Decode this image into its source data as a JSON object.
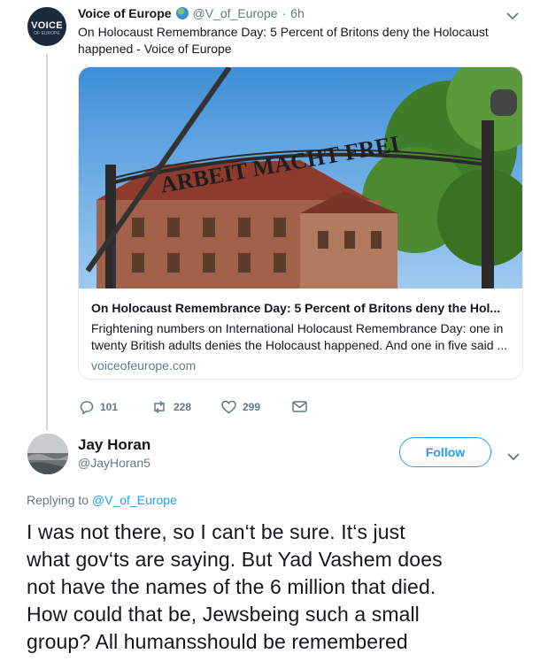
{
  "tweet1": {
    "avatar_text": "VOICE",
    "avatar_subtext": "OF EUROPE",
    "name": "Voice of Europe",
    "handle": "@V_of_Europe",
    "separator": "·",
    "time": "6h",
    "text": "On Holocaust Remembrance Day: 5 Percent of Britons deny the Holocaust happened - Voice of Europe",
    "card": {
      "title": "On Holocaust Remembrance Day: 5 Percent of Britons deny the Hol...",
      "desc_line1": "Frightening numbers on International Holocaust Remembrance Day: one in",
      "desc_line2": "twenty British adults denies the Holocaust happened. And one in five said ...",
      "domain": "voiceofeurope.com",
      "image_sign_text": "ARBEIT MACHT FREI"
    },
    "actions": {
      "replies": "101",
      "retweets": "228",
      "likes": "299"
    }
  },
  "tweet2": {
    "name": "Jay Horan",
    "handle": "@JayHoran5",
    "follow_label": "Follow",
    "replying_prefix": "Replying to",
    "replying_to": "@V_of_Europe",
    "text_lines": [
      "I was not there, so I can‘t be sure. It‘s just",
      "what gov‘ts are saying. But Yad Vashem does",
      "not have the names of the 6 million that died.",
      "How could that be, Jewsbeing such a small",
      "group? All humansshould be remembered"
    ]
  },
  "colors": {
    "accent": "#1da1f2",
    "muted": "#657786",
    "text": "#14171a",
    "border": "#e1e8ed"
  }
}
